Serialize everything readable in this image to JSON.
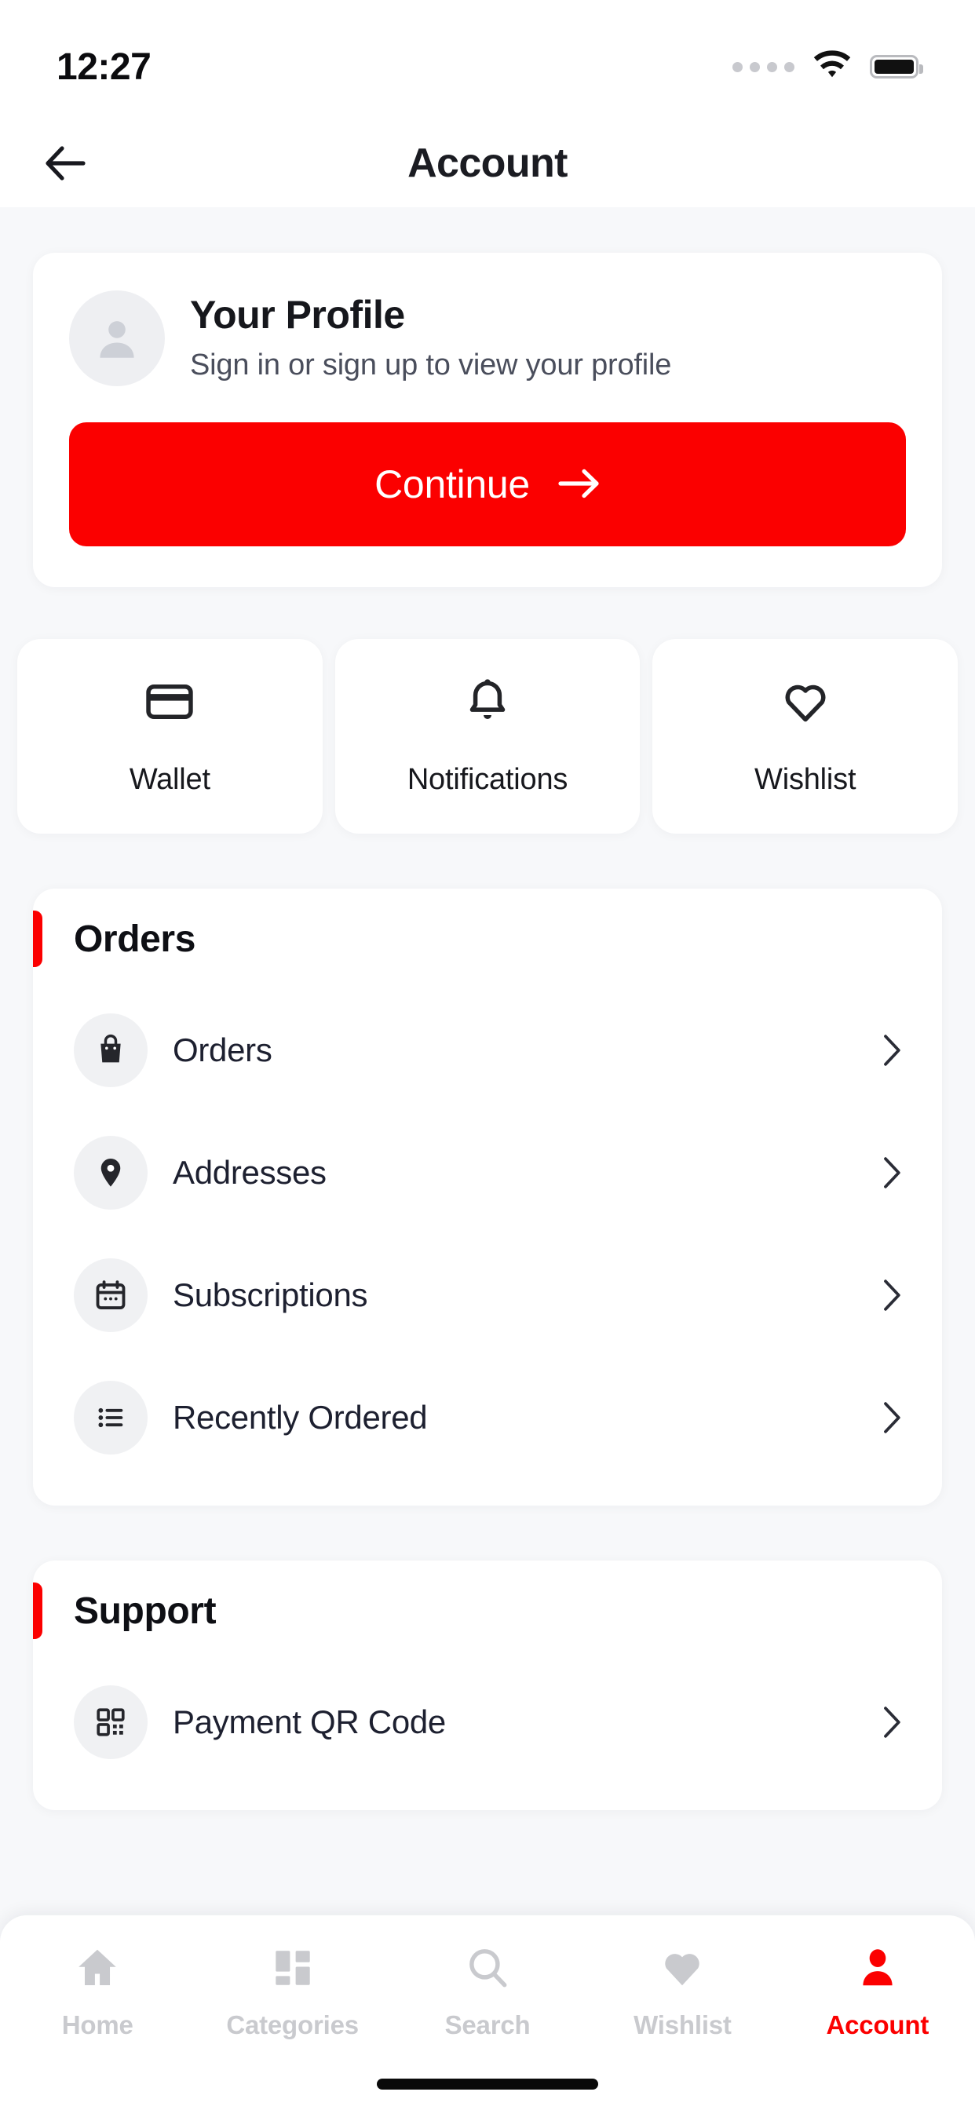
{
  "status_bar": {
    "time": "12:27",
    "signal_icon": "signal-dots-icon",
    "wifi_icon": "wifi-icon",
    "battery_icon": "battery-full-icon"
  },
  "header": {
    "title": "Account",
    "back_icon": "arrow-left-icon"
  },
  "profile": {
    "avatar_icon": "user-avatar-icon",
    "name": "Your Profile",
    "subtitle": "Sign in or sign up to view your profile",
    "continue_label": "Continue",
    "continue_icon": "arrow-right-icon"
  },
  "quick_tiles": [
    {
      "label": "Wallet",
      "icon": "credit-card-icon"
    },
    {
      "label": "Notifications",
      "icon": "bell-icon"
    },
    {
      "label": "Wishlist",
      "icon": "heart-outline-icon"
    }
  ],
  "sections": [
    {
      "title": "Orders",
      "rows": [
        {
          "label": "Orders",
          "icon": "shopping-bag-icon",
          "chevron": "chevron-right-icon"
        },
        {
          "label": "Addresses",
          "icon": "map-pin-icon",
          "chevron": "chevron-right-icon"
        },
        {
          "label": "Subscriptions",
          "icon": "calendar-icon",
          "chevron": "chevron-right-icon"
        },
        {
          "label": "Recently Ordered",
          "icon": "list-icon",
          "chevron": "chevron-right-icon"
        }
      ]
    },
    {
      "title": "Support",
      "rows": [
        {
          "label": "Payment QR Code",
          "icon": "qr-code-icon",
          "chevron": "chevron-right-icon"
        }
      ]
    }
  ],
  "bottom_nav": [
    {
      "label": "Home",
      "icon": "home-icon",
      "active": false
    },
    {
      "label": "Categories",
      "icon": "grid-icon",
      "active": false
    },
    {
      "label": "Search",
      "icon": "search-icon",
      "active": false
    },
    {
      "label": "Wishlist",
      "icon": "heart-filled-icon",
      "active": false
    },
    {
      "label": "Account",
      "icon": "person-icon",
      "active": true
    }
  ],
  "colors": {
    "accent_red": "#FB0000",
    "page_bg": "#F7F8FA",
    "card_bg": "#FFFFFF",
    "text_primary": "#16171C",
    "text_secondary": "#4A4E5C",
    "nav_inactive": "#C9CACE"
  }
}
